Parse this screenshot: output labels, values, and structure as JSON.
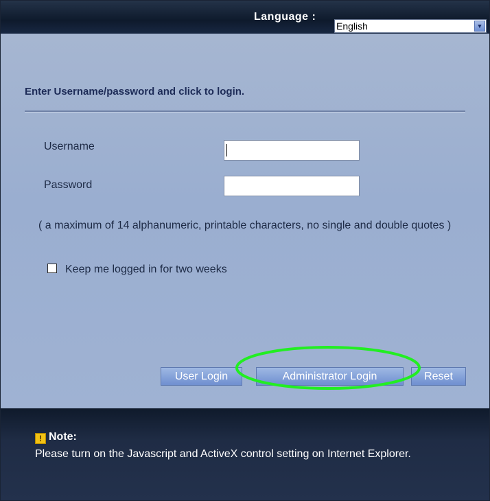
{
  "header": {
    "language_label": "Language :",
    "language_selected": "English"
  },
  "login": {
    "instruction": "Enter Username/password and click to login.",
    "username_label": "Username",
    "password_label": "Password",
    "username_value": "",
    "password_value": "",
    "hint": "( a maximum of 14 alphanumeric, printable characters, no single and double quotes )",
    "keep_logged_label": "Keep me logged in for two weeks",
    "keep_logged_checked": false
  },
  "buttons": {
    "user_login": "User Login",
    "admin_login": "Administrator Login",
    "reset": "Reset"
  },
  "note": {
    "title": "Note:",
    "text": "Please turn on the Javascript and ActiveX control setting on Internet Explorer."
  },
  "colors": {
    "highlight_ellipse": "#22ee22",
    "button_blue": "#7f9ed8",
    "panel": "#9fb2d3"
  }
}
